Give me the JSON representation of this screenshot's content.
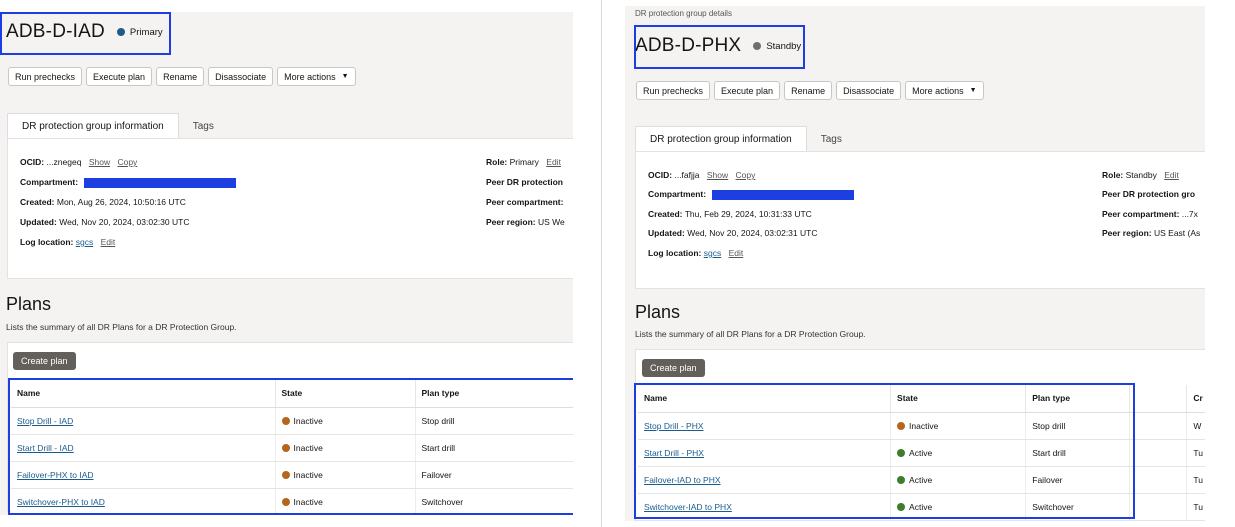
{
  "left": {
    "title": "ADB-D-IAD",
    "role_badge": "Primary",
    "role_color": "#1e5c87",
    "actions": [
      "Run prechecks",
      "Execute plan",
      "Rename",
      "Disassociate",
      "More actions"
    ],
    "tabs": [
      "DR protection group information",
      "Tags"
    ],
    "ocid_label": "OCID:",
    "ocid_value": "...znegeq",
    "show": "Show",
    "copy": "Copy",
    "compartment_label": "Compartment:",
    "created_label": "Created:",
    "created_value": "Mon, Aug 26, 2024, 10:50:16 UTC",
    "updated_label": "Updated:",
    "updated_value": "Wed, Nov 20, 2024, 03:02:30 UTC",
    "log_label": "Log location:",
    "log_value": "sgcs",
    "edit": "Edit",
    "role_label": "Role:",
    "role_value": "Primary",
    "peer_dr_label": "Peer DR protection",
    "peer_comp_label": "Peer compartment:",
    "peer_region_label": "Peer region:",
    "peer_region_value": "US We",
    "plans_title": "Plans",
    "plans_desc": "Lists the summary of all DR Plans for a DR Protection Group.",
    "create_plan": "Create plan",
    "columns": [
      "Name",
      "State",
      "Plan type"
    ],
    "rows": [
      {
        "name": "Stop Drill - IAD",
        "state": "Inactive",
        "state_color": "#b5651d",
        "type": "Stop drill"
      },
      {
        "name": "Start Drill - IAD",
        "state": "Inactive",
        "state_color": "#b5651d",
        "type": "Start drill"
      },
      {
        "name": "Failover-PHX to IAD",
        "state": "Inactive",
        "state_color": "#b5651d",
        "type": "Failover"
      },
      {
        "name": "Switchover-PHX to IAD",
        "state": "Inactive",
        "state_color": "#b5651d",
        "type": "Switchover"
      }
    ]
  },
  "right": {
    "breadcrumb": "DR protection group details",
    "title": "ADB-D-PHX",
    "role_badge": "Standby",
    "role_color": "#6f6f6f",
    "actions": [
      "Run prechecks",
      "Execute plan",
      "Rename",
      "Disassociate",
      "More actions"
    ],
    "tabs": [
      "DR protection group information",
      "Tags"
    ],
    "ocid_label": "OCID:",
    "ocid_value": "...fafjja",
    "show": "Show",
    "copy": "Copy",
    "compartment_label": "Compartment:",
    "created_label": "Created:",
    "created_value": "Thu, Feb 29, 2024, 10:31:33 UTC",
    "updated_label": "Updated:",
    "updated_value": "Wed, Nov 20, 2024, 03:02:31 UTC",
    "log_label": "Log location:",
    "log_value": "sgcs",
    "edit": "Edit",
    "role_label": "Role:",
    "role_value": "Standby",
    "peer_dr_label": "Peer DR protection gro",
    "peer_comp_label": "Peer compartment:",
    "peer_comp_value": "...7x",
    "peer_region_label": "Peer region:",
    "peer_region_value": "US East (As",
    "plans_title": "Plans",
    "plans_desc": "Lists the summary of all DR Plans for a DR Protection Group.",
    "create_plan": "Create plan",
    "columns": [
      "Name",
      "State",
      "Plan type",
      "",
      "Cr"
    ],
    "rows": [
      {
        "name": "Stop Drill - PHX",
        "state": "Inactive",
        "state_color": "#b5651d",
        "type": "Stop drill",
        "extra": "W"
      },
      {
        "name": "Start Drill - PHX",
        "state": "Active",
        "state_color": "#3f7d2c",
        "type": "Start drill",
        "extra": "Tu"
      },
      {
        "name": "Failover-IAD to PHX",
        "state": "Active",
        "state_color": "#3f7d2c",
        "type": "Failover",
        "extra": "Tu"
      },
      {
        "name": "Switchover-IAD to PHX",
        "state": "Active",
        "state_color": "#3f7d2c",
        "type": "Switchover",
        "extra": "Tu"
      }
    ]
  }
}
